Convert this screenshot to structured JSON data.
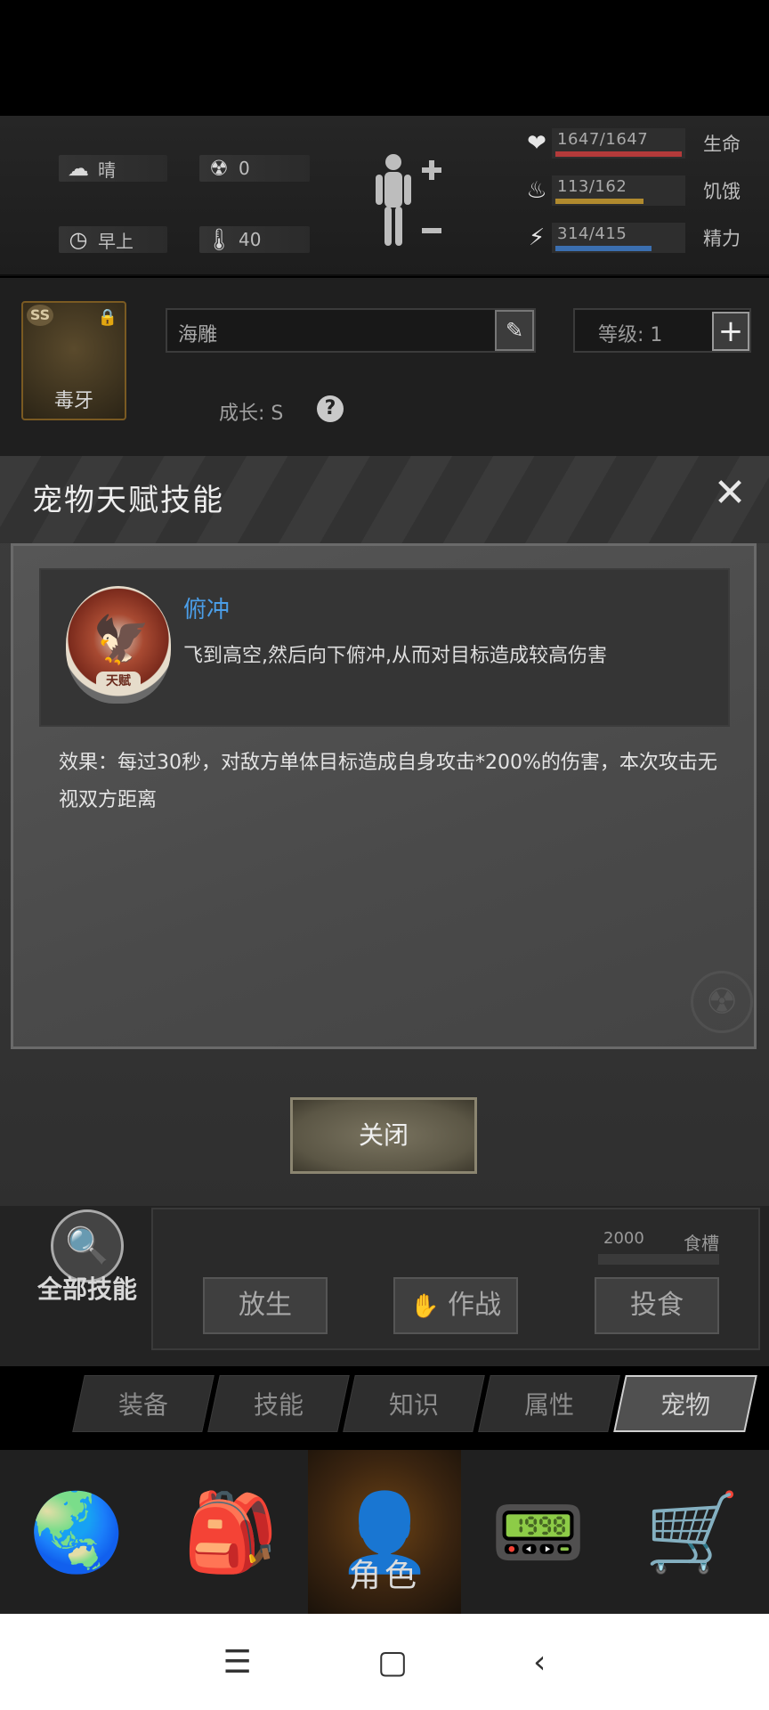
{
  "top": {
    "weather": "晴",
    "radiation": "0",
    "time_of_day": "早上",
    "temperature": "40",
    "icons": {
      "weather": "cloud-sun-icon",
      "radiation": "radiation-icon",
      "clock": "clock-icon",
      "thermometer": "thermometer-icon",
      "body": "body-status-icon"
    }
  },
  "stats": [
    {
      "value": "1647/1647",
      "label": "生命",
      "fraction": 1.0,
      "color": "#b33a3a",
      "icon": "heart-pulse-icon"
    },
    {
      "value": "113/162",
      "label": "饥饿",
      "fraction": 0.7,
      "color": "#b08a2e",
      "icon": "stomach-icon"
    },
    {
      "value": "314/415",
      "label": "精力",
      "fraction": 0.76,
      "color": "#3b6fb0",
      "icon": "energy-icon"
    }
  ],
  "pet": {
    "grade": "SS",
    "name_label": "毒牙",
    "name_field": "海雕",
    "level_label": "等级: 1",
    "growth_label": "成长: S"
  },
  "dialog": {
    "title": "宠物天赋技能",
    "skill_tag": "天赋",
    "skill_name": "俯冲",
    "skill_desc": "飞到高空,然后向下俯冲,从而对目标造成较高伤害",
    "effect": "效果：每过30秒，对敌方单体目标造成自身攻击*200%的伤害，本次攻击无视双方距离",
    "close_label": "关闭"
  },
  "lower": {
    "all_skills_label": "全部技能",
    "food_value": "2000",
    "food_label": "食槽",
    "actions": [
      "放生",
      "作战",
      "投食"
    ]
  },
  "tabs": [
    {
      "label": "装备",
      "active": false
    },
    {
      "label": "技能",
      "active": false
    },
    {
      "label": "知识",
      "active": false
    },
    {
      "label": "属性",
      "active": false
    },
    {
      "label": "宠物",
      "active": true
    }
  ],
  "nav": {
    "items": [
      "globe-icon",
      "backpack-icon",
      "character-icon",
      "radio-icon",
      "cart-icon"
    ],
    "active_caption": "角色"
  },
  "system_nav": [
    "menu-icon",
    "home-icon",
    "back-icon"
  ]
}
